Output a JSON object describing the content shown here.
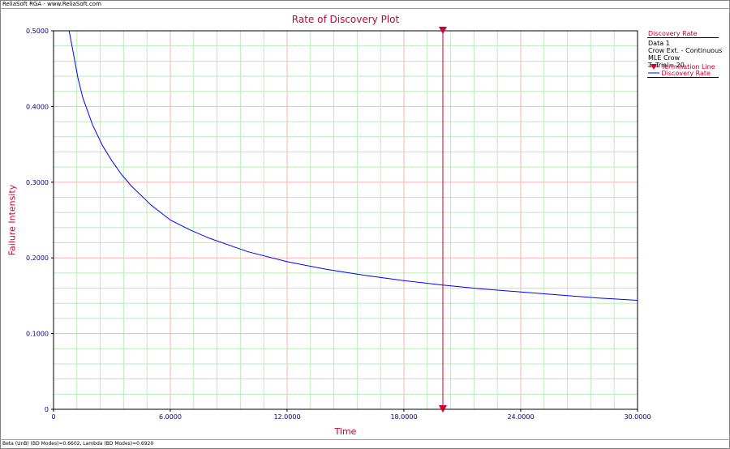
{
  "app": {
    "title": "ReliaSoft RGA - www.ReliaSoft.com"
  },
  "status_bar": {
    "text": "Beta (UnB) (BD Modes)=0.6602, Lambda (BD Modes)=0.6920"
  },
  "legend": {
    "title": "Discovery Rate",
    "info_lines": [
      "Data 1",
      "Crow Ext. - Continuous",
      "MLE Crow",
      "T. Trial= 20"
    ],
    "entries": [
      {
        "label": "Termination Line",
        "color": "#cc0033",
        "marker": "triangle-down-icon"
      },
      {
        "label": "Discovery Rate",
        "color": "#0000ff",
        "marker": "line"
      }
    ]
  },
  "colors": {
    "title": "#cc0033",
    "curve": "#0000ff",
    "termination": "#cc0033",
    "major_grid": "#ffb3b3",
    "minor_grid": "#b8ecb8",
    "tick_label": "#000080"
  },
  "chart_data": {
    "type": "line",
    "title": "Rate of Discovery Plot",
    "xlabel": "Time",
    "ylabel": "Failure Intensity",
    "xlim": [
      0,
      30
    ],
    "ylim": [
      0,
      0.5
    ],
    "x_ticks": [
      "0",
      "6.0000",
      "12.0000",
      "18.0000",
      "24.0000",
      "30.0000"
    ],
    "y_ticks": [
      "0",
      "0.1000",
      "0.2000",
      "0.3000",
      "0.4000",
      "0.5000"
    ],
    "grid": true,
    "legend_position": "right",
    "termination_line_x": 20,
    "series": [
      {
        "name": "Discovery Rate",
        "x": [
          0.8,
          1.0,
          1.25,
          1.5,
          2.0,
          2.5,
          3.0,
          3.5,
          4.0,
          5.0,
          6.0,
          7.0,
          8.0,
          9.0,
          10.0,
          12.0,
          14.0,
          16.0,
          18.0,
          20.0,
          22.0,
          24.0,
          26.0,
          28.0,
          30.0
        ],
        "y": [
          0.5,
          0.473,
          0.438,
          0.412,
          0.376,
          0.349,
          0.328,
          0.31,
          0.295,
          0.27,
          0.25,
          0.237,
          0.226,
          0.217,
          0.208,
          0.195,
          0.185,
          0.177,
          0.17,
          0.164,
          0.159,
          0.155,
          0.151,
          0.147,
          0.144
        ]
      }
    ]
  }
}
